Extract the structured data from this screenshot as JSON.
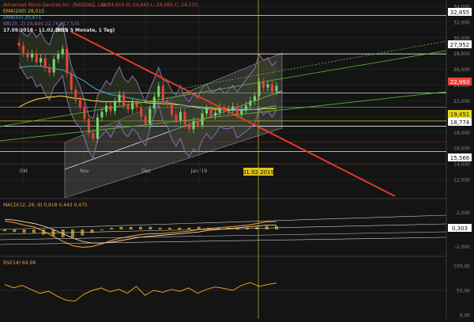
{
  "header": {
    "instrument": "Advanced Micro Devices Inc. (NASDAQ, Last)",
    "ohlc": "O: 24,610  H: 24,640  L: 24,065  C: 24,510",
    "ema200": "EMA(200) 28,015",
    "ema50": "EMA(50) 20,671",
    "bollinger": "BB(20, 2) 24,840  22,762  17,535",
    "period": "17.09.2018 - 11.02.2019",
    "interval": "(EST, 5 Monate, 1 Tag)"
  },
  "colors": {
    "background": "#141414",
    "grid": "#2a2a2a",
    "bull_candle": "#7bd46d",
    "bear_candle": "#e8433b",
    "ema200": "#e0c21d",
    "ema50": "#4aa8d8",
    "bollinger": "#8a6fb0",
    "trend_red": "#e03a28",
    "channel": "#9a9a9a",
    "price_tag": "#e8433b",
    "cursor": "#e0c21d"
  },
  "price_tags": {
    "t1": "32,855",
    "t2": "27,952",
    "current": "22,993",
    "t3": "19,451",
    "t4": "18,774",
    "t5": "15,566"
  },
  "cursor_date": "01.02.2019",
  "macd_title": "MACD(12, 26, 9) 0,918  0,443  0,475",
  "macd_tag": "0,303",
  "rsi_title": "RSI(14) 64,98",
  "chart_data": {
    "type": "line",
    "title": "Advanced Micro Devices Inc. (NASDAQ, Last)",
    "x_labels": [
      "Okt",
      "Nov",
      "Dez",
      "Jan '19"
    ],
    "price_axis": [
      "34,000",
      "32,000",
      "30,000",
      "28,000",
      "26,000",
      "24,000",
      "22,000",
      "20,000",
      "18,000",
      "16,000",
      "14,000",
      "12,000"
    ],
    "ylim": [
      11.5,
      34.2
    ],
    "close": [
      29.0,
      28.1,
      27.5,
      28.0,
      26.9,
      27.4,
      26.2,
      25.6,
      27.3,
      27.9,
      28.6,
      25.5,
      23.4,
      22.1,
      21.2,
      19.7,
      17.9,
      17.2,
      19.9,
      20.6,
      21.4,
      20.7,
      21.9,
      22.8,
      21.4,
      20.9,
      21.8,
      21.2,
      20.0,
      19.1,
      21.0,
      22.5,
      23.9,
      22.0,
      21.6,
      20.2,
      19.5,
      20.6,
      19.0,
      18.4,
      19.4,
      18.9,
      20.4,
      21.0,
      20.1,
      20.5,
      21.2,
      20.7,
      20.9,
      21.3,
      20.2,
      20.8,
      21.4,
      22.0,
      22.6,
      24.4,
      23.7,
      24.1,
      23.2,
      23.9
    ],
    "ema200": [
      21.2,
      21.5,
      21.8,
      22.0,
      22.2,
      22.3,
      22.4,
      22.5,
      22.5,
      22.6,
      22.6,
      22.5,
      22.4,
      22.3,
      22.3,
      22.2,
      22.1,
      22.0,
      22.0,
      21.9,
      21.9,
      21.9,
      21.9,
      21.9,
      21.9,
      21.9,
      21.9,
      21.9,
      21.8,
      21.8,
      21.7,
      21.7,
      21.7,
      21.6,
      21.6,
      21.6,
      21.5,
      21.5,
      21.4,
      21.3,
      21.3,
      21.2,
      21.2,
      21.1,
      21.1,
      21.0,
      21.0,
      21.0,
      20.9,
      20.9,
      20.9,
      20.9,
      20.9,
      20.9,
      20.9,
      20.9,
      21.0,
      21.0,
      21.0,
      21.0
    ],
    "ema50": [
      26.2,
      26.3,
      26.4,
      26.4,
      26.4,
      26.4,
      26.3,
      26.2,
      26.1,
      26.0,
      25.9,
      25.7,
      25.4,
      25.1,
      24.8,
      24.5,
      24.1,
      23.7,
      23.4,
      23.2,
      23.0,
      22.8,
      22.7,
      22.6,
      22.5,
      22.4,
      22.3,
      22.2,
      22.1,
      22.0,
      21.9,
      21.9,
      21.9,
      21.9,
      21.8,
      21.7,
      21.6,
      21.5,
      21.4,
      21.3,
      21.2,
      21.1,
      21.0,
      21.0,
      20.9,
      20.9,
      20.9,
      20.8,
      20.8,
      20.8,
      20.8,
      20.8,
      20.8,
      20.9,
      20.9,
      21.0,
      21.1,
      21.2,
      21.3,
      21.4
    ],
    "macd_axis": [
      "2,000",
      "0,000",
      "-2,000"
    ],
    "macd_ylim": [
      -2.6,
      2.6
    ],
    "macd": [
      1.0,
      0.8,
      0.5,
      0.3,
      -0.2,
      -0.8,
      -1.4,
      -1.9,
      -2.1,
      -2.0,
      -1.7,
      -1.3,
      -1.0,
      -0.8,
      -0.6,
      -0.5,
      -0.5,
      -0.4,
      -0.3,
      -0.2,
      0.0,
      0.1,
      0.2,
      0.3,
      0.4,
      0.5,
      0.7,
      0.9,
      0.9
    ],
    "macd_signal": [
      1.2,
      1.1,
      0.9,
      0.7,
      0.4,
      0.0,
      -0.5,
      -1.0,
      -1.4,
      -1.6,
      -1.6,
      -1.5,
      -1.3,
      -1.1,
      -0.9,
      -0.8,
      -0.7,
      -0.6,
      -0.5,
      -0.4,
      -0.3,
      -0.1,
      0.0,
      0.1,
      0.2,
      0.3,
      0.4,
      0.5,
      0.5
    ],
    "rsi_axis": [
      "100,00",
      "50,00",
      "0,00"
    ],
    "rsi": [
      62,
      55,
      60,
      52,
      44,
      48,
      38,
      30,
      28,
      42,
      50,
      55,
      47,
      52,
      44,
      58,
      40,
      50,
      46,
      52,
      48,
      55,
      44,
      52,
      57,
      54,
      50,
      60,
      66,
      58,
      62,
      65
    ]
  }
}
